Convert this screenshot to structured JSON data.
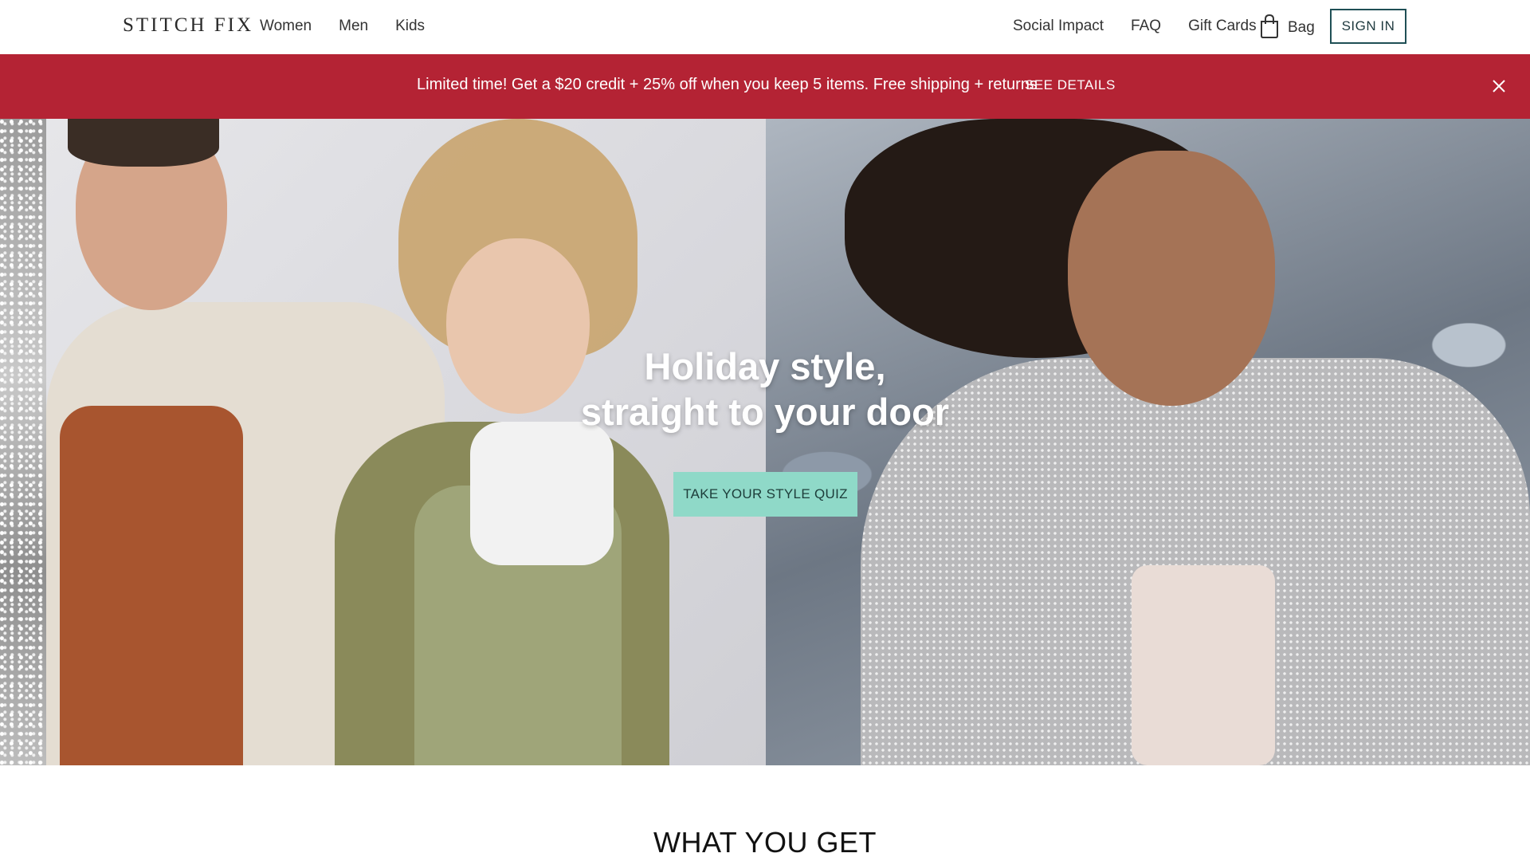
{
  "header": {
    "logo": "STITCH FIX",
    "nav_left": [
      "Women",
      "Men",
      "Kids"
    ],
    "nav_right": [
      "Social Impact",
      "FAQ",
      "Gift Cards"
    ],
    "bag_label": "Bag",
    "sign_in": "SIGN IN"
  },
  "promo": {
    "text": "Limited time! Get a $20 credit + 25% off when you keep 5 items. Free shipping + returns",
    "link": "SEE DETAILS",
    "background": "#b42334"
  },
  "hero": {
    "title_line1": "Holiday style,",
    "title_line2": "straight to your door",
    "cta": "TAKE YOUR STYLE QUIZ",
    "cta_color": "#8fd9c8"
  },
  "section": {
    "title": "WHAT YOU GET"
  }
}
